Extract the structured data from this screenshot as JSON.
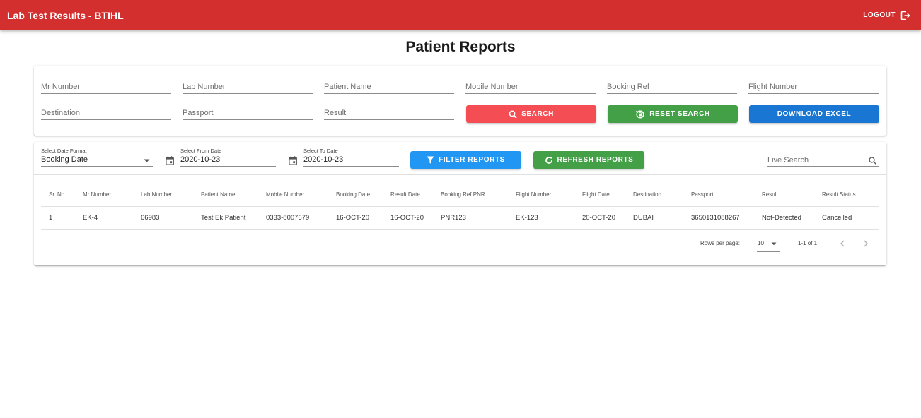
{
  "header": {
    "title": "Lab Test Results - BTIHL",
    "logout_label": "LOGOUT"
  },
  "page": {
    "title": "Patient Reports"
  },
  "search": {
    "fields": {
      "mr_number": "Mr Number",
      "lab_number": "Lab Number",
      "patient_name": "Patient Name",
      "mobile_number": "Mobile Number",
      "booking_ref": "Booking Ref",
      "flight_number": "Flight Number",
      "destination": "Destination",
      "passport": "Passport",
      "result": "Result"
    },
    "buttons": {
      "search": "SEARCH",
      "reset": "RESET SEARCH",
      "download": "DOWNLOAD EXCEL"
    }
  },
  "filters": {
    "date_format_label": "Select Date Format",
    "date_format_value": "Booking Date",
    "from_label": "Select From Date",
    "from_value": "2020-10-23",
    "to_label": "Select To Date",
    "to_value": "2020-10-23",
    "filter_button": "FILTER REPORTS",
    "refresh_button": "REFRESH REPORTS",
    "live_search_placeholder": "Live Search"
  },
  "table": {
    "columns": [
      "Sr. No",
      "Mr Number",
      "Lab Number",
      "Patient Name",
      "Mobile Number",
      "Booking Date",
      "Result Date",
      "Booking Ref PNR",
      "Flight Number",
      "Flight Date",
      "Destination",
      "Passport",
      "Result",
      "Result Status"
    ],
    "rows": [
      [
        "1",
        "EK-4",
        "66983",
        "Test Ek Patient",
        "0333-8007679",
        "16-OCT-20",
        "16-OCT-20",
        "PNR123",
        "EK-123",
        "20-OCT-20",
        "DUBAI",
        "3650131088267",
        "Not-Detected",
        "Cancelled"
      ]
    ]
  },
  "pagination": {
    "rows_per_page_label": "Rows per page:",
    "rows_per_page": "10",
    "range": "1-1 of 1"
  },
  "colors": {
    "appbar": "#d32f2f",
    "search": "#f44e54",
    "reset": "#43a047",
    "download": "#1976d2",
    "filter": "#2196f3",
    "refresh": "#43a047"
  },
  "icons": [
    "logout-icon",
    "search-icon",
    "reset-icon",
    "filter-icon",
    "refresh-icon",
    "calendar-icon",
    "chevron-down-icon",
    "chevron-left-icon",
    "chevron-right-icon"
  ]
}
